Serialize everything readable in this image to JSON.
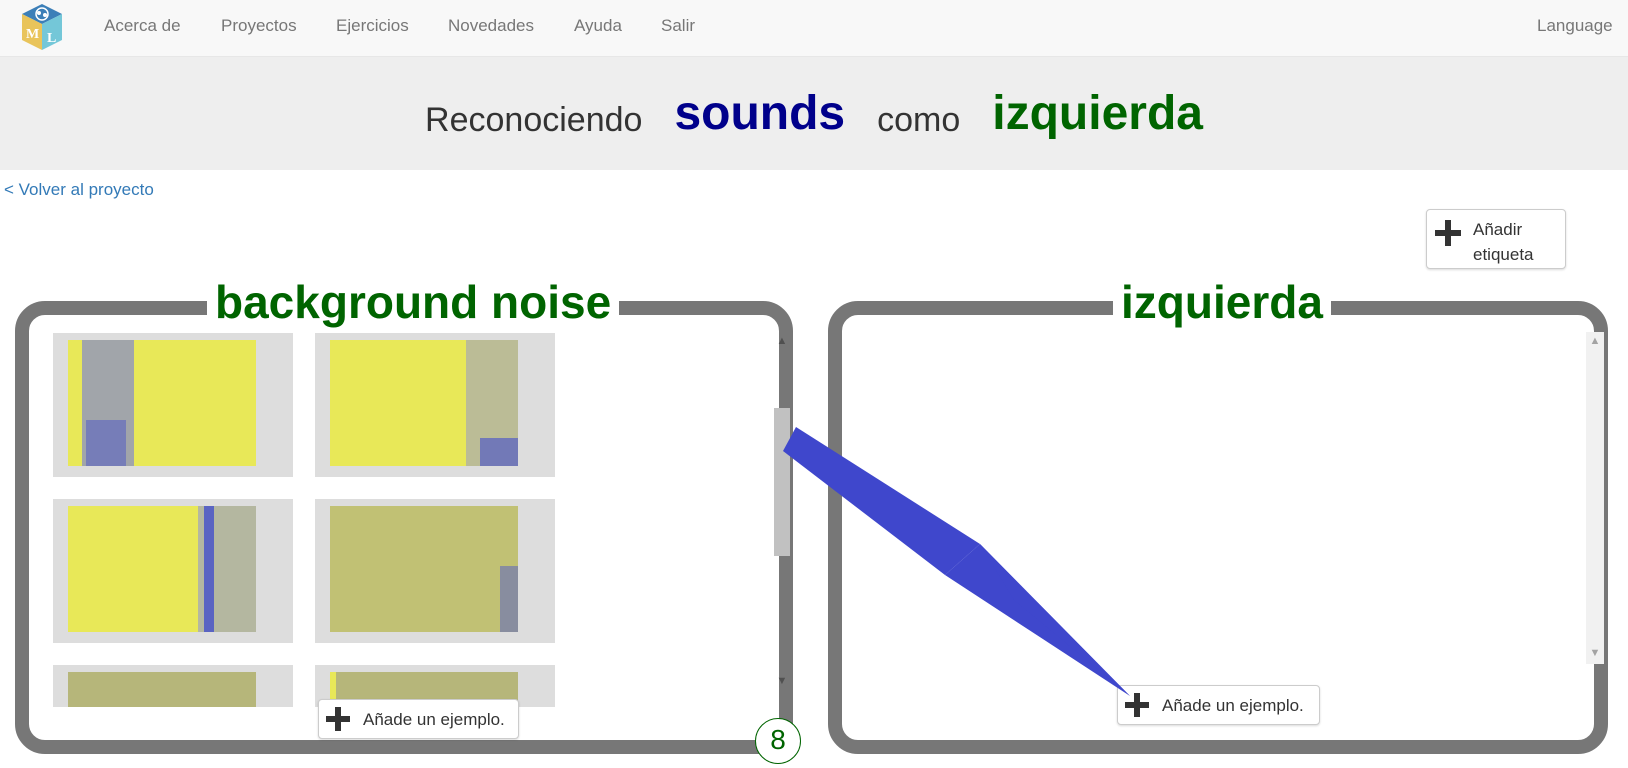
{
  "navbar": {
    "logo_letters": [
      "M",
      "L"
    ],
    "items": [
      {
        "label": "Acerca de"
      },
      {
        "label": "Proyectos"
      },
      {
        "label": "Ejercicios"
      },
      {
        "label": "Novedades"
      },
      {
        "label": "Ayuda"
      },
      {
        "label": "Salir"
      }
    ],
    "language_label": "Language"
  },
  "header": {
    "prefix": "Reconociendo",
    "project_type": "sounds",
    "connector": "como",
    "label": "izquierda"
  },
  "back_link": "< Volver al proyecto",
  "add_label_button": {
    "line1": "Añadir",
    "line2": "etiqueta"
  },
  "buckets": [
    {
      "title": "background noise",
      "add_example_label": "Añade un ejemplo.",
      "example_count": "8",
      "thumbnail_type": "spectrogram"
    },
    {
      "title": "izquierda",
      "add_example_label": "Añade un ejemplo."
    }
  ],
  "colors": {
    "label_green": "#006400",
    "type_blue": "#00008b",
    "link_blue": "#337ab7",
    "spectrogram_yellow": "#e8e858",
    "spectrogram_blue": "#4a56c8",
    "arrow_blue": "#3f47cc"
  }
}
